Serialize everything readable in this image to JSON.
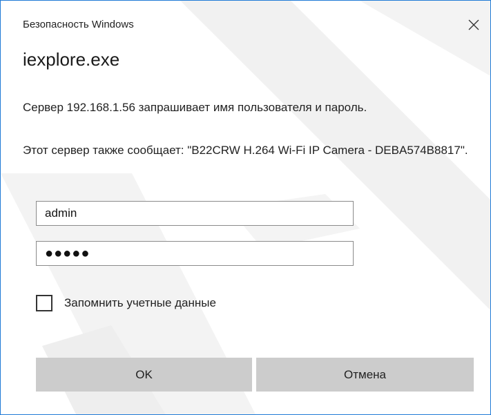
{
  "window": {
    "title": "Безопасность Windows",
    "close_icon": "close-icon"
  },
  "dialog": {
    "app_name": "iexplore.exe",
    "message": "Сервер 192.168.1.56 запрашивает имя пользователя и пароль.",
    "server_message": "Этот сервер также сообщает: \"B22CRW H.264 Wi-Fi IP Camera - DEBA574B8817\"."
  },
  "form": {
    "username_value": "admin",
    "password_display": "●●●●●",
    "remember_label": "Запомнить учетные данные",
    "remember_checked": false
  },
  "buttons": {
    "ok_label": "OK",
    "cancel_label": "Отмена"
  },
  "colors": {
    "border_accent": "#1f7ad6",
    "button_bg": "#cccccc",
    "watermark": "#f0f0f0"
  }
}
